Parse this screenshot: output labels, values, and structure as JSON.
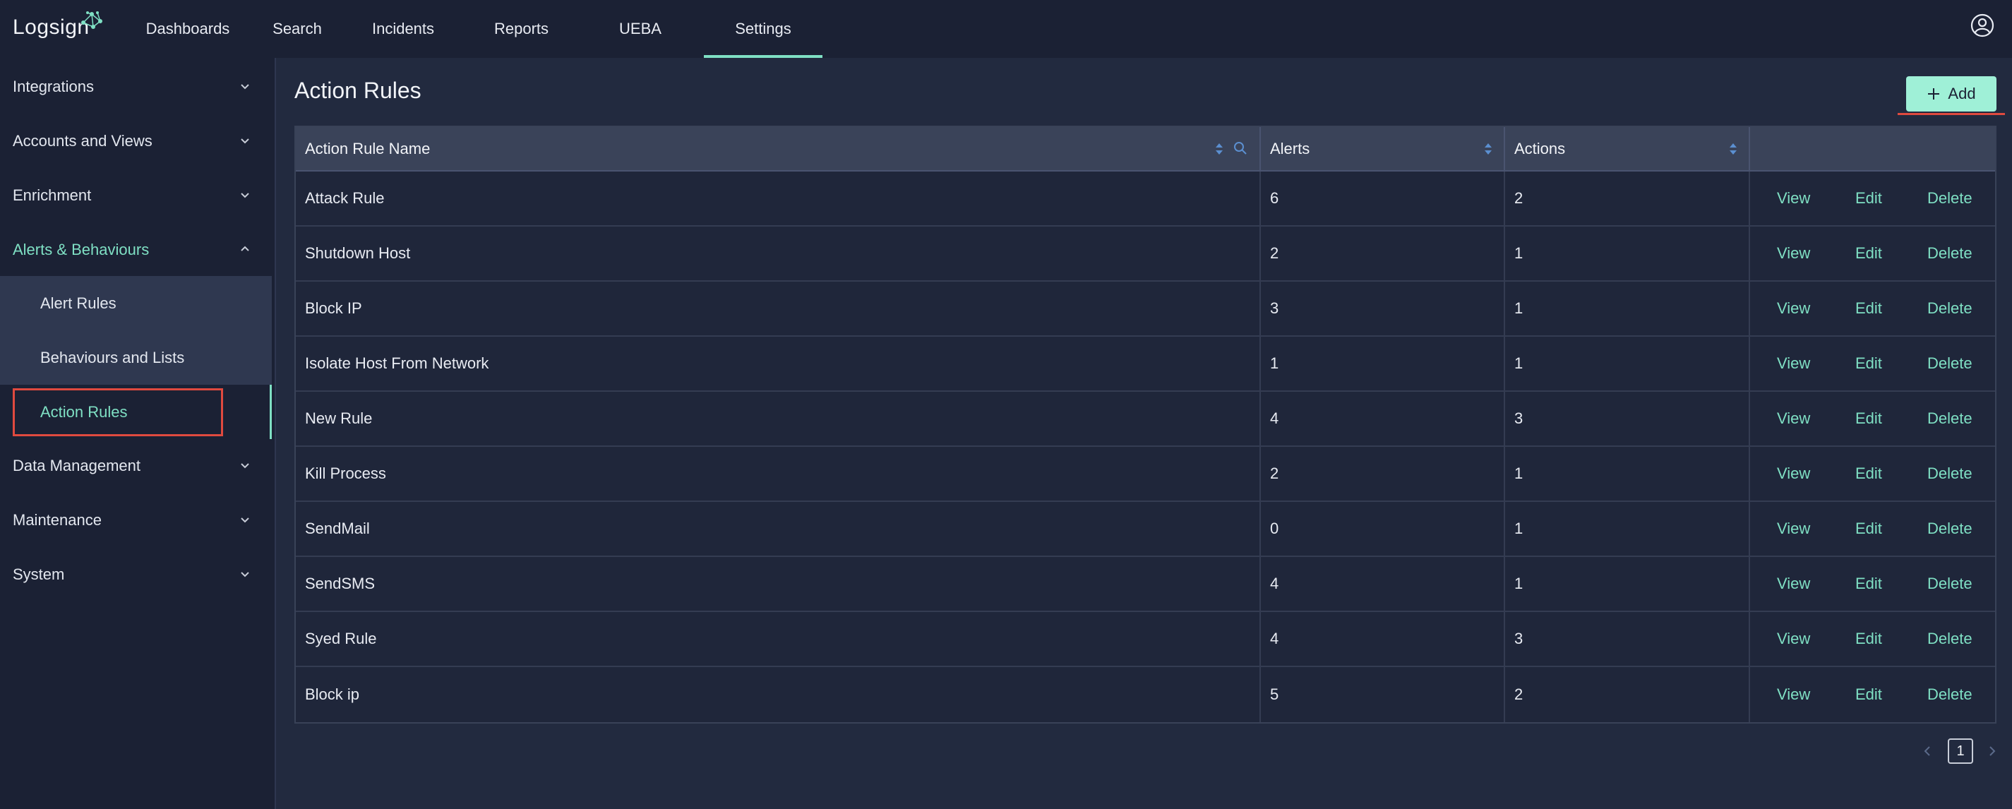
{
  "app": {
    "logo_text": "Logsign",
    "accent_color": "#7fe0c4"
  },
  "topnav": {
    "items": [
      {
        "label": "Dashboards",
        "active": false
      },
      {
        "label": "Search",
        "active": false
      },
      {
        "label": "Incidents",
        "active": false
      },
      {
        "label": "Reports",
        "active": false
      },
      {
        "label": "UEBA",
        "active": false
      },
      {
        "label": "Settings",
        "active": true
      }
    ],
    "user_icon": "user-circle-icon"
  },
  "sidebar": {
    "sections": [
      {
        "label": "Integrations",
        "expanded": false
      },
      {
        "label": "Accounts and Views",
        "expanded": false
      },
      {
        "label": "Enrichment",
        "expanded": false
      },
      {
        "label": "Alerts & Behaviours",
        "expanded": true
      },
      {
        "label": "Data Management",
        "expanded": false
      },
      {
        "label": "Maintenance",
        "expanded": false
      },
      {
        "label": "System",
        "expanded": false
      }
    ],
    "subitems": [
      {
        "label": "Alert Rules",
        "active": false
      },
      {
        "label": "Behaviours and Lists",
        "active": false
      },
      {
        "label": "Action Rules",
        "active": true
      }
    ]
  },
  "main": {
    "title": "Action Rules",
    "add_label": "Add",
    "columns": [
      "Action Rule Name",
      "Alerts",
      "Actions",
      ""
    ],
    "action_labels": {
      "view": "View",
      "edit": "Edit",
      "delete": "Delete"
    },
    "rows": [
      {
        "name": "Attack Rule",
        "alerts": "6",
        "actions": "2"
      },
      {
        "name": "Shutdown Host",
        "alerts": "2",
        "actions": "1"
      },
      {
        "name": "Block IP",
        "alerts": "3",
        "actions": "1"
      },
      {
        "name": "Isolate Host From Network",
        "alerts": "1",
        "actions": "1"
      },
      {
        "name": "New Rule",
        "alerts": "4",
        "actions": "3"
      },
      {
        "name": "Kill Process",
        "alerts": "2",
        "actions": "1"
      },
      {
        "name": "SendMail",
        "alerts": "0",
        "actions": "1"
      },
      {
        "name": "SendSMS",
        "alerts": "4",
        "actions": "1"
      },
      {
        "name": "Syed Rule",
        "alerts": "4",
        "actions": "3"
      },
      {
        "name": "Block ip",
        "alerts": "5",
        "actions": "2"
      }
    ],
    "pagination": {
      "current_page": "1"
    }
  }
}
